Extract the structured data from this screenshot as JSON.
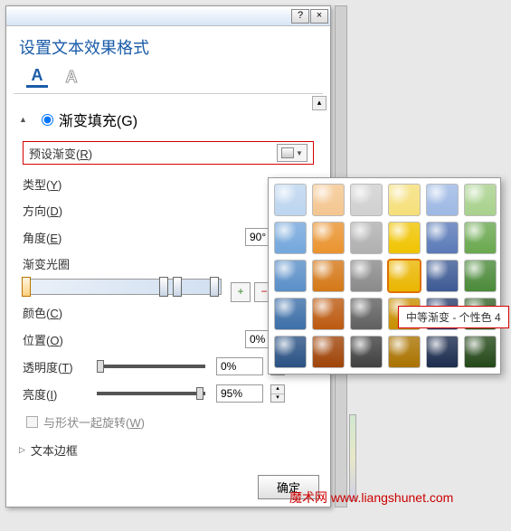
{
  "titlebar": {
    "help": "?",
    "close": "×"
  },
  "dialog": {
    "title": "设置文本效果格式"
  },
  "mode": {
    "fill": "A",
    "outline": "A"
  },
  "sections": {
    "gradient_fill": "渐变填充(G)",
    "text_border": "文本边框"
  },
  "preset": {
    "label": "预设渐变(R)"
  },
  "fields": {
    "type": "类型(Y)",
    "direction": "方向(D)",
    "angle": "角度(E)",
    "angle_val": "90°",
    "stops": "渐变光圈",
    "color": "颜色(C)",
    "position": "位置(O)",
    "position_val": "0%",
    "transparency": "透明度(T)",
    "transparency_val": "0%",
    "brightness": "亮度(I)",
    "brightness_val": "95%",
    "rotate": "与形状一起旋转(W)"
  },
  "buttons": {
    "ok": "确定"
  },
  "tooltip": "中等渐变 - 个性色 4",
  "palette": {
    "rows": [
      [
        "#bcd5ef",
        "#f4c690",
        "#d0d0d0",
        "#f5df7a",
        "#9db8e4",
        "#a8d18d"
      ],
      [
        "#74a7dc",
        "#ea932e",
        "#b0b0b0",
        "#f0c400",
        "#5a7ab8",
        "#6aa84f"
      ],
      [
        "#5a8fc8",
        "#d47817",
        "#8a8a8a",
        "#eab600",
        "#3d5a94",
        "#4b8a3a"
      ],
      [
        "#3d6fa8",
        "#bc5a10",
        "#606060",
        "#c88f00",
        "#2a3f6e",
        "#356428"
      ],
      [
        "#2a5284",
        "#a04408",
        "#404040",
        "#aa7300",
        "#1c2c4e",
        "#244818"
      ]
    ],
    "selected": [
      2,
      3
    ]
  },
  "watermark": {
    "t1": "魔术网 ",
    "t2": "www.liangshunet.com"
  }
}
